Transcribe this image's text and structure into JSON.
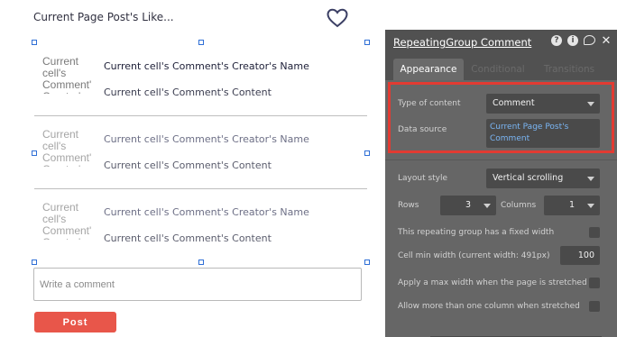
{
  "canvas": {
    "title": "Current Page Post's Like...",
    "cells": [
      {
        "avatar_text": "Current cell's Comment' Creator's",
        "creator": "Current cell's Comment's Creator's Name",
        "content": "Current cell's Comment's Content"
      },
      {
        "avatar_text": "Current cell's Comment' Creator's",
        "creator": "Current cell's Comment's Creator's Name",
        "content": "Current cell's Comment's Content"
      },
      {
        "avatar_text": "Current cell's Comment' Creator's",
        "creator": "Current cell's Comment's Creator's Name",
        "content": "Current cell's Comment's Content"
      }
    ],
    "comment_input": {
      "placeholder": "Write a comment",
      "value": ""
    },
    "post_button": "Post"
  },
  "panel": {
    "title": "RepeatingGroup Comment",
    "icons": [
      "help-icon",
      "info-icon",
      "comment-bubble-icon",
      "close-icon"
    ],
    "tabs": [
      "Appearance",
      "Conditional",
      "Transitions"
    ],
    "active_tab": "Appearance",
    "type_of_content": {
      "label": "Type of content",
      "value": "Comment"
    },
    "data_source": {
      "label": "Data source",
      "value": "Current Page Post's Comment"
    },
    "layout_style": {
      "label": "Layout style",
      "value": "Vertical scrolling"
    },
    "rows": {
      "label": "Rows",
      "value": "3"
    },
    "columns": {
      "label": "Columns",
      "value": "1"
    },
    "fixed_width": {
      "label": "This repeating group has a fixed width",
      "checked": false
    },
    "cell_min_width": {
      "label": "Cell min width (current width: 491px)",
      "value": "100"
    },
    "max_width": {
      "label": "Apply a max width when the page is stretched",
      "checked": false
    },
    "multi_column": {
      "label": "Allow more than one column when stretched",
      "checked": false
    }
  },
  "colors": {
    "accent_red": "#e8564a",
    "highlight_red": "#e23b32",
    "selection_blue": "#2f6fd6",
    "link_blue": "#7ab6f5",
    "panel_bg": "#666666"
  }
}
